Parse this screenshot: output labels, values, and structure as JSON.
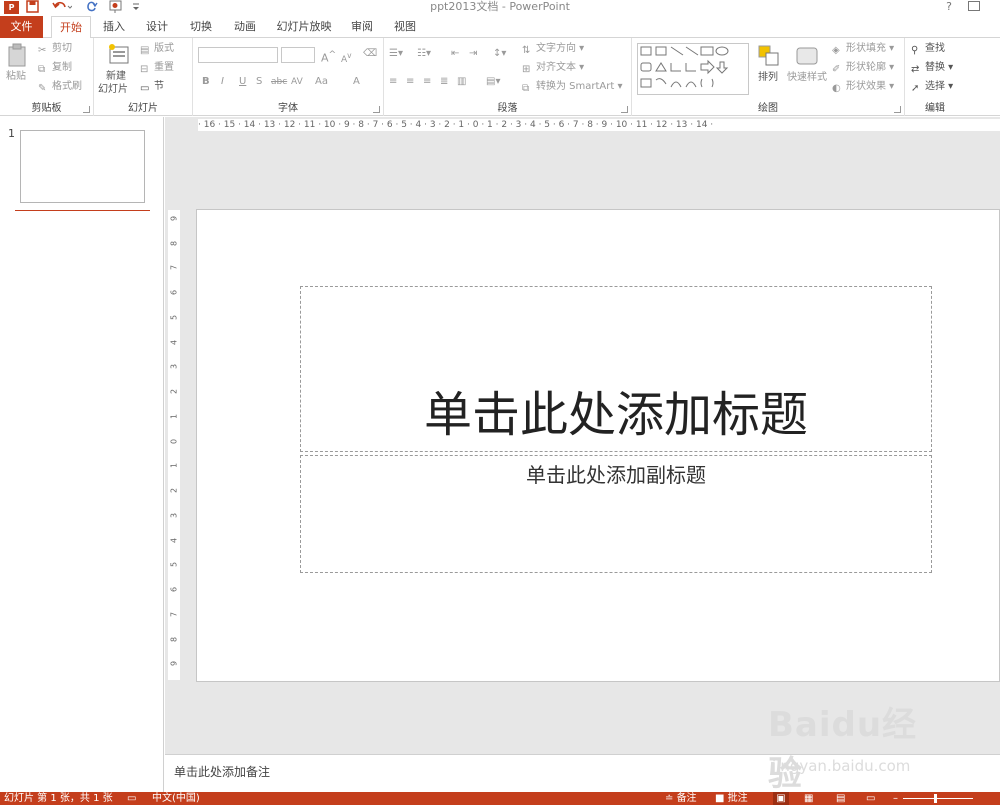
{
  "app": {
    "doc_title": "ppt2013文档 - PowerPoint",
    "help": "?",
    "icon_text": "P"
  },
  "quick_access": [
    "save-icon",
    "undo-icon",
    "redo-icon",
    "start-from-beginning-icon",
    "customize-icon"
  ],
  "tabs": [
    {
      "label": "文件"
    },
    {
      "label": "开始"
    },
    {
      "label": "插入"
    },
    {
      "label": "设计"
    },
    {
      "label": "切换"
    },
    {
      "label": "动画"
    },
    {
      "label": "幻灯片放映"
    },
    {
      "label": "审阅"
    },
    {
      "label": "视图"
    }
  ],
  "ribbon": {
    "clipboard": {
      "label": "剪贴板",
      "paste": "粘贴",
      "cut": "剪切",
      "copy": "复制",
      "format_painter": "格式刷"
    },
    "slides": {
      "label": "幻灯片",
      "new_slide_1": "新建",
      "new_slide_2": "幻灯片",
      "layout": "版式",
      "reset": "重置",
      "section": "节"
    },
    "font": {
      "label": "字体",
      "bold": "B",
      "italic": "I",
      "underline": "U",
      "shadow": "S",
      "strike": "abc",
      "spacing": "AV",
      "case": "Aa",
      "color": "A",
      "grow": "A",
      "shrink": "A"
    },
    "paragraph": {
      "label": "段落",
      "text_direction": "文字方向",
      "align_text": "对齐文本",
      "smartart": "转换为 SmartArt"
    },
    "drawing": {
      "label": "绘图",
      "arrange": "排列",
      "quick_styles": "快速样式",
      "shape_fill": "形状填充",
      "shape_outline": "形状轮廓",
      "shape_effects": "形状效果"
    },
    "editing": {
      "label": "编辑",
      "find": "查找",
      "replace": "替换",
      "select": "选择"
    }
  },
  "thumbnails": {
    "slide_number": "1"
  },
  "rulers": {
    "horizontal": "· 16 · 15 · 14 · 13 · 12 · 11 · 10 · 9 · 8 · 7 · 6 · 5 · 4 · 3 · 2 · 1 · 0 · 1 · 2 · 3 · 4 · 5 · 6 · 7 · 8 · 9 · 10 · 11 · 12 · 13 · 14 ·",
    "vertical": [
      "9",
      "8",
      "7",
      "6",
      "5",
      "4",
      "3",
      "2",
      "1",
      "0",
      "1",
      "2",
      "3",
      "4",
      "5",
      "6",
      "7",
      "8",
      "9"
    ]
  },
  "slide": {
    "title_placeholder": "单击此处添加标题",
    "subtitle_placeholder": "单击此处添加副标题"
  },
  "notes": {
    "placeholder": "单击此处添加备注"
  },
  "status": {
    "slide_info": "幻灯片 第 1 张，共 1 张",
    "language": "中文(中国)",
    "notes": "备注",
    "comments": "批注"
  },
  "watermark": {
    "brand": "Baidu经验",
    "url": "jingyan.baidu.com"
  },
  "colors": {
    "accent": "#c43e1c"
  }
}
